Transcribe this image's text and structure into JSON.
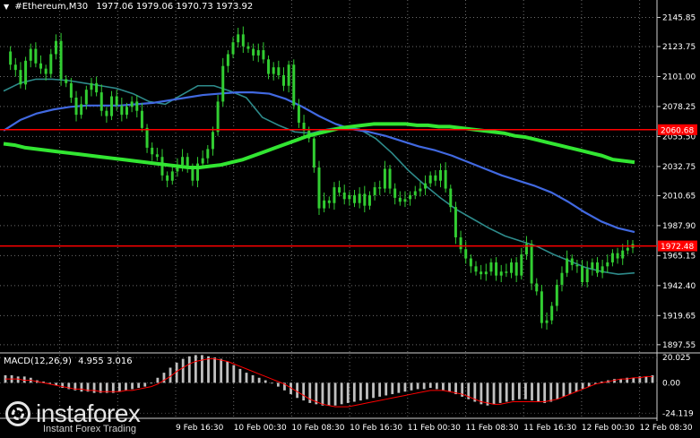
{
  "header": {
    "symbol": "#Ethereum,M30",
    "ohlc": "1977.06 1979.06 1970.73 1973.92"
  },
  "macd": {
    "label": "MACD(12,26,9)",
    "values": "4.955 3.016"
  },
  "brand": {
    "name": "instaforex",
    "tagline": "Instant Forex Trading"
  },
  "colors": {
    "background": "#000000",
    "candles": "#32cd32",
    "ma_slow": "#32e632",
    "ma_blue": "#4169e1",
    "ma_teal": "#2e8b8b",
    "level_line": "#ff0000",
    "macd_hist": "#c0c0c0",
    "macd_signal": "#ff0000"
  },
  "chart_data": {
    "type": "line",
    "price_axis": {
      "ylim": [
        1892,
        2155
      ],
      "ticks": [
        "2145.85",
        "2123.75",
        "2101.00",
        "2078.25",
        "2055.50",
        "2032.75",
        "2010.65",
        "1987.90",
        "1965.15",
        "1942.40",
        "1919.65",
        "1897.55"
      ]
    },
    "macd_axis": {
      "ylim": [
        -26,
        23
      ],
      "ticks": [
        "20.025",
        "0.00",
        "-24.119"
      ]
    },
    "time_labels": [
      "9 Feb 16:30",
      "10 Feb 00:30",
      "10 Feb 08:30",
      "10 Feb 16:30",
      "11 Feb 00:30",
      "11 Feb 08:30",
      "11 Feb 16:30",
      "12 Feb 00:30",
      "12 Feb 08:30"
    ],
    "levels": [
      {
        "value": 2060.68,
        "label": "2060.68"
      },
      {
        "value": 1972.48,
        "label": "1972.48"
      }
    ],
    "close": [
      2120,
      2110,
      2106,
      2095,
      2113,
      2122,
      2111,
      2107,
      2103,
      2118,
      2128,
      2099,
      2096,
      2085,
      2072,
      2080,
      2091,
      2096,
      2089,
      2075,
      2071,
      2086,
      2079,
      2072,
      2078,
      2082,
      2075,
      2062,
      2047,
      2042,
      2040,
      2026,
      2022,
      2029,
      2034,
      2040,
      2031,
      2022,
      2035,
      2039,
      2046,
      2059,
      2082,
      2109,
      2118,
      2127,
      2133,
      2124,
      2122,
      2117,
      2121,
      2114,
      2103,
      2108,
      2102,
      2094,
      2110,
      2079,
      2066,
      2060,
      2054,
      2032,
      2001,
      2007,
      2005,
      2017,
      2013,
      2008,
      2011,
      2005,
      2012,
      2003,
      2011,
      2017,
      2016,
      2031,
      2016,
      2009,
      2006,
      2008,
      2011,
      2014,
      2016,
      2020,
      2026,
      2022,
      2030,
      2016,
      2002,
      1979,
      1970,
      1963,
      1957,
      1953,
      1951,
      1953,
      1960,
      1950,
      1953,
      1952,
      1960,
      1950,
      1966,
      1974,
      1944,
      1938,
      1914,
      1916,
      1927,
      1943,
      1952,
      1963,
      1958,
      1957,
      1945,
      1955,
      1960,
      1952,
      1957,
      1960,
      1967,
      1963,
      1969,
      1971,
      1973.92
    ],
    "ma_slow": [
      2050,
      2049,
      2047,
      2046,
      2045,
      2044,
      2043,
      2042,
      2041,
      2040,
      2039,
      2038,
      2037,
      2036,
      2035,
      2034,
      2033,
      2032,
      2032,
      2033,
      2034,
      2036,
      2038,
      2041,
      2044,
      2047,
      2050,
      2053,
      2056,
      2058,
      2060,
      2062,
      2063,
      2064,
      2065,
      2065,
      2065,
      2065,
      2064,
      2064,
      2063,
      2063,
      2062,
      2061,
      2060,
      2059,
      2058,
      2056,
      2055,
      2053,
      2051,
      2049,
      2047,
      2045,
      2043,
      2041,
      2038,
      2037,
      2036
    ],
    "ma_blue": [
      2060,
      2068,
      2073,
      2076,
      2078,
      2079,
      2079,
      2079,
      2080,
      2081,
      2083,
      2085,
      2087,
      2088,
      2089,
      2089,
      2088,
      2084,
      2078,
      2071,
      2065,
      2061,
      2059,
      2056,
      2052,
      2048,
      2045,
      2041,
      2036,
      2031,
      2026,
      2022,
      2018,
      2013,
      2006,
      1998,
      1991,
      1986,
      1983
    ],
    "ma_teal": [
      2090,
      2096,
      2099,
      2099,
      2098,
      2096,
      2094,
      2092,
      2088,
      2082,
      2080,
      2087,
      2094,
      2094,
      2090,
      2085,
      2070,
      2064,
      2059,
      2058,
      2061,
      2063,
      2061,
      2054,
      2043,
      2030,
      2019,
      2009,
      2000,
      1993,
      1986,
      1980,
      1976,
      1972,
      1966,
      1961,
      1956,
      1953,
      1951,
      1952
    ],
    "macd_hist": [
      6,
      6,
      5,
      5,
      4,
      2,
      1,
      -1,
      -2,
      -4,
      -5,
      -6,
      -7,
      -7,
      -8,
      -8,
      -8,
      -8,
      -7,
      -6,
      -5,
      -4,
      -3,
      0,
      4,
      8,
      12,
      16,
      19,
      21,
      22,
      22,
      21,
      20,
      19,
      17,
      14,
      11,
      8,
      6,
      4,
      2,
      0,
      -3,
      -6,
      -9,
      -12,
      -14,
      -16,
      -17,
      -18,
      -18,
      -18,
      -17,
      -16,
      -15,
      -14,
      -13,
      -12,
      -11,
      -10,
      -9,
      -8,
      -7,
      -6,
      -5,
      -5,
      -4,
      -5,
      -6,
      -7,
      -9,
      -11,
      -13,
      -15,
      -17,
      -18,
      -17,
      -16,
      -15,
      -14,
      -13,
      -13,
      -14,
      -15,
      -16,
      -15,
      -13,
      -11,
      -9,
      -7,
      -5,
      -3,
      -1,
      1,
      2,
      3,
      3,
      4,
      4,
      5,
      5,
      6
    ],
    "macd_signal": [
      3,
      3,
      3,
      2,
      2,
      1,
      0,
      -1,
      -2,
      -3,
      -4,
      -5,
      -5,
      -6,
      -6,
      -7,
      -7,
      -7,
      -7,
      -6,
      -6,
      -5,
      -4,
      -3,
      -1,
      2,
      5,
      9,
      12,
      15,
      17,
      18,
      19,
      19,
      18,
      17,
      15,
      13,
      11,
      9,
      7,
      5,
      3,
      1,
      -1,
      -4,
      -7,
      -10,
      -13,
      -15,
      -17,
      -18,
      -19,
      -19,
      -19,
      -18,
      -17,
      -16,
      -15,
      -14,
      -13,
      -12,
      -11,
      -10,
      -9,
      -8,
      -7,
      -6,
      -6,
      -6,
      -7,
      -8,
      -9,
      -11,
      -13,
      -15,
      -16,
      -17,
      -17,
      -16,
      -15,
      -15,
      -15,
      -15,
      -15,
      -15,
      -14,
      -13,
      -11,
      -9,
      -7,
      -5,
      -3,
      -1,
      0,
      1,
      2,
      3,
      3,
      4,
      4,
      5,
      5
    ]
  }
}
